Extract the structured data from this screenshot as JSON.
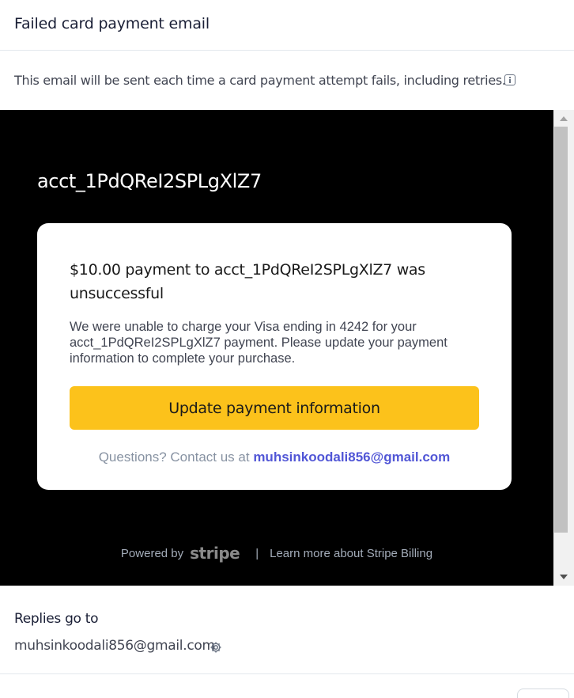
{
  "header": {
    "title": "Failed card payment email"
  },
  "description": {
    "text": "This email will be sent each time a card payment attempt fails, including retries."
  },
  "preview": {
    "account_title": "acct_1PdQReI2SPLgXlZ7",
    "card": {
      "heading": "$10.00 payment to acct_1PdQReI2SPLgXlZ7 was unsuccessful",
      "body": "We were unable to charge your Visa ending in 4242 for your acct_1PdQReI2SPLgXlZ7 payment. Please update your payment information to complete your purchase.",
      "button_label": "Update payment information",
      "questions_prefix": "Questions? Contact us at",
      "contact_email": "muhsinkoodali856@gmail.com"
    },
    "footer": {
      "powered_by": "Powered by",
      "stripe_logo": "stripe",
      "separator": "|",
      "learn_more": "Learn more about Stripe Billing"
    }
  },
  "replies": {
    "label": "Replies go to",
    "email": "muhsinkoodali856@gmail.com"
  },
  "colors": {
    "button": "#fcc21b",
    "link": "#5156d6",
    "preview_bg": "#000000"
  }
}
